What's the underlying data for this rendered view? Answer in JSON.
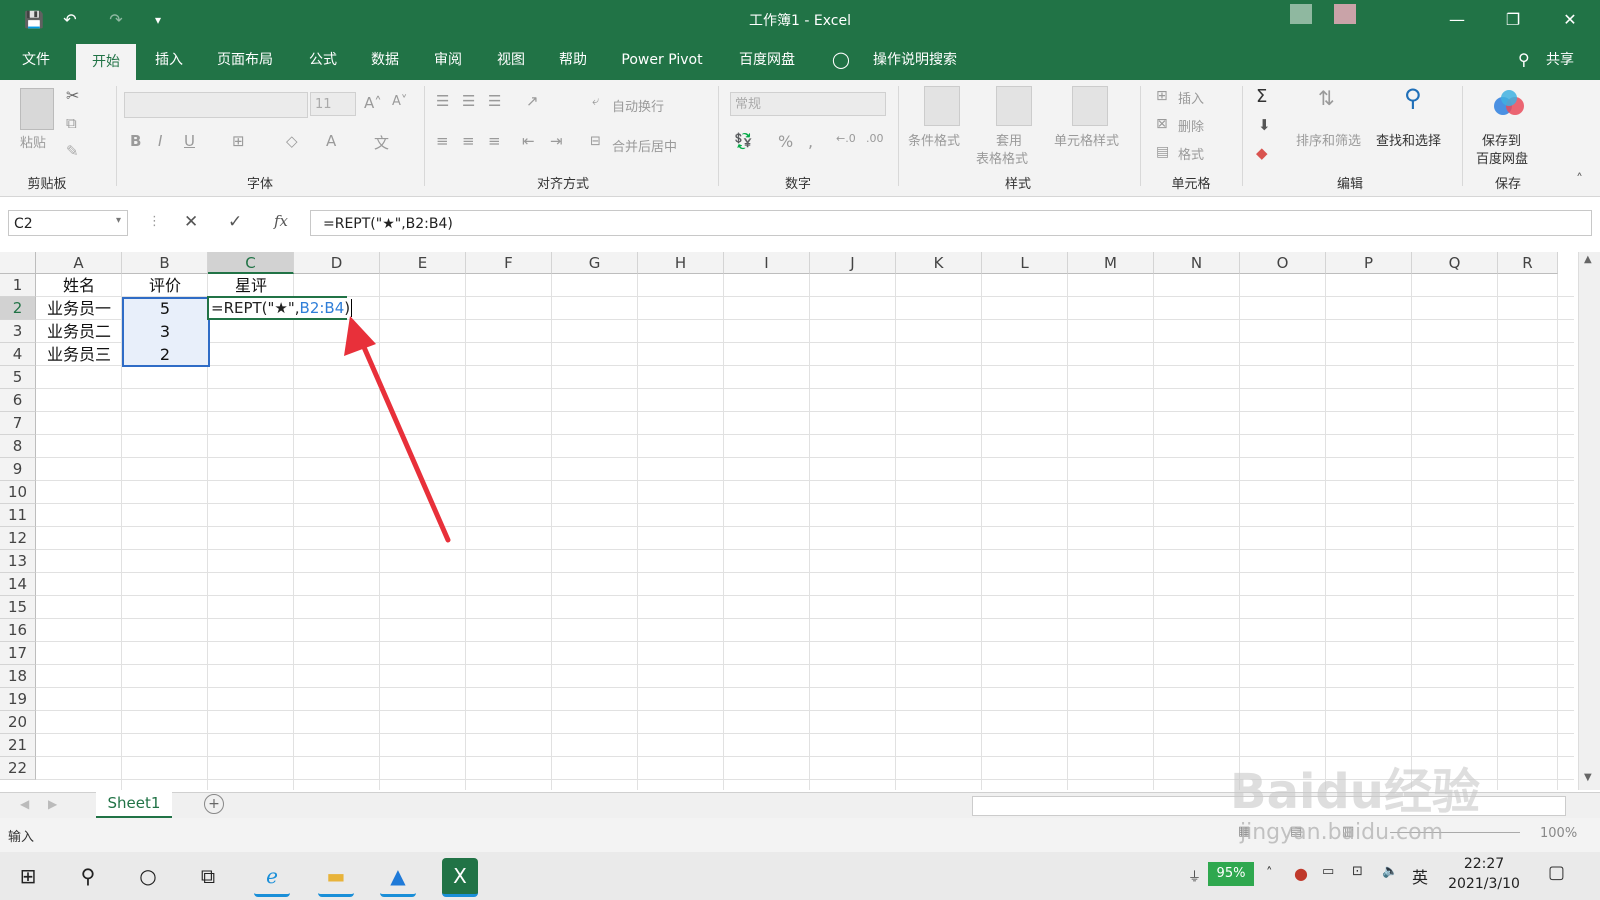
{
  "window": {
    "title": "工作簿1  -  Excel",
    "quick_access": {
      "save": "💾",
      "undo": "↶",
      "redo": "↷",
      "customize": "▾"
    },
    "controls": {
      "minimize": "—",
      "restore": "❐",
      "close": "✕"
    }
  },
  "tabs": [
    {
      "label": "文件"
    },
    {
      "label": "开始"
    },
    {
      "label": "插入"
    },
    {
      "label": "页面布局"
    },
    {
      "label": "公式"
    },
    {
      "label": "数据"
    },
    {
      "label": "审阅"
    },
    {
      "label": "视图"
    },
    {
      "label": "帮助"
    },
    {
      "label": "Power Pivot"
    },
    {
      "label": "百度网盘"
    }
  ],
  "tell_me": "操作说明搜索",
  "share": "共享",
  "ribbon": {
    "groups": {
      "clipboard": "剪贴板",
      "font": "字体",
      "align": "对齐方式",
      "number": "数字",
      "styles": "样式",
      "cells": "单元格",
      "editing": "编辑",
      "save": "保存"
    },
    "paste": "粘贴",
    "font_size": "11",
    "wrap_text": "自动换行",
    "merge_center": "合并后居中",
    "number_format": "常规",
    "cond_format": "条件格式",
    "table_format_1": "套用",
    "table_format_2": "表格格式",
    "cell_styles": "单元格样式",
    "insert": "插入",
    "delete": "删除",
    "format": "格式",
    "sort_filter": "排序和筛选",
    "find_select": "查找和选择",
    "save_baidu_1": "保存到",
    "save_baidu_2": "百度网盘"
  },
  "formula_bar": {
    "name_box": "C2",
    "cancel": "✕",
    "enter": "✓",
    "fx": "fx",
    "formula": "=REPT(\"★\",B2:B4)"
  },
  "columns": [
    "A",
    "B",
    "C",
    "D",
    "E",
    "F",
    "G",
    "H",
    "I",
    "J",
    "K",
    "L",
    "M",
    "N",
    "O",
    "P",
    "Q",
    "R"
  ],
  "rows": [
    "1",
    "2",
    "3",
    "4",
    "5",
    "6",
    "7",
    "8",
    "9",
    "10",
    "11",
    "12",
    "13",
    "14",
    "15",
    "16",
    "17",
    "18",
    "19",
    "20",
    "21",
    "22"
  ],
  "cells": {
    "A1": "姓名",
    "B1": "评价",
    "C1": "星评",
    "A2": "业务员一",
    "B2": "5",
    "A3": "业务员二",
    "B3": "3",
    "A4": "业务员三",
    "B4": "2",
    "C2_prefix": "=REPT(\"★\",",
    "C2_ref": "B2:B4",
    "C2_suffix": ")"
  },
  "sheet_tabs": [
    {
      "label": "Sheet1"
    }
  ],
  "status": {
    "mode": "输入",
    "zoom": "100%"
  },
  "watermark": {
    "line1": "Baidu经验",
    "line2": "jingyan.baidu.com"
  },
  "taskbar": {
    "battery": "95%",
    "ime": "英",
    "time": "22:27",
    "date": "2021/3/10"
  },
  "colors": {
    "excel_green": "#217346",
    "ref_blue": "#2f7ed8",
    "arrow_red": "#e8303a"
  }
}
